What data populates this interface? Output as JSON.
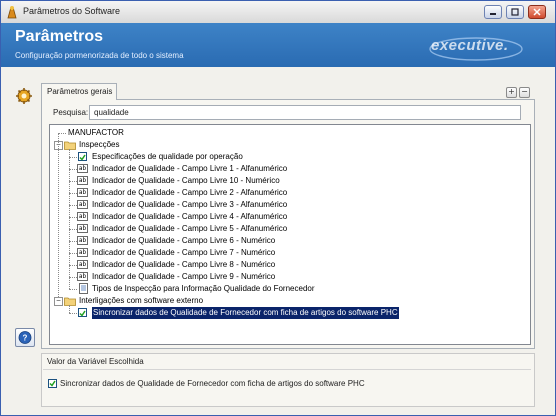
{
  "window": {
    "title": "Parâmetros do Software"
  },
  "header": {
    "title": "Parâmetros",
    "subtitle": "Configuração pormenorizada de todo o sistema",
    "logo": "executive."
  },
  "tabs": [
    {
      "label": "Parâmetros gerais"
    }
  ],
  "search": {
    "label": "Pesquisa:",
    "value": "qualidade"
  },
  "tree": {
    "root": "MANUFACTOR",
    "groups": [
      {
        "label": "Inspecções",
        "items": [
          {
            "icon": "checkbox",
            "label": "Especificações de qualidade por operação"
          },
          {
            "icon": "text",
            "label": "Indicador de Qualidade - Campo Livre 1 - Alfanumérico"
          },
          {
            "icon": "text",
            "label": "Indicador de Qualidade - Campo Livre 10 - Numérico"
          },
          {
            "icon": "text",
            "label": "Indicador de Qualidade - Campo Livre 2 - Alfanumérico"
          },
          {
            "icon": "text",
            "label": "Indicador de Qualidade - Campo Livre 3 - Alfanumérico"
          },
          {
            "icon": "text",
            "label": "Indicador de Qualidade - Campo Livre 4 - Alfanumérico"
          },
          {
            "icon": "text",
            "label": "Indicador de Qualidade - Campo Livre 5 - Alfanumérico"
          },
          {
            "icon": "text",
            "label": "Indicador de Qualidade - Campo Livre 6 - Numérico"
          },
          {
            "icon": "text",
            "label": "Indicador de Qualidade - Campo Livre 7 - Numérico"
          },
          {
            "icon": "text",
            "label": "Indicador de Qualidade - Campo Livre 8 - Numérico"
          },
          {
            "icon": "text",
            "label": "Indicador de Qualidade - Campo Livre 9 - Numérico"
          },
          {
            "icon": "document",
            "label": "Tipos de Inspecção para Informação Qualidade do Fornecedor"
          }
        ]
      },
      {
        "label": "Interligações com software externo",
        "items": [
          {
            "icon": "checkbox",
            "label": "Sincronizar dados de Qualidade de Fornecedor com ficha de artigos do software PHC",
            "selected": true
          }
        ]
      }
    ]
  },
  "icon_text": "ab",
  "expander_symbol": "−",
  "value_panel": {
    "title": "Valor da Variável Escolhida",
    "value_label": "Sincronizar dados de Qualidade de Fornecedor com ficha de artigos do software PHC",
    "checked": true
  },
  "buttons": {
    "add": "+",
    "remove": "−"
  },
  "colors": {
    "header": "#2f74bd",
    "selection": "#0a246a"
  }
}
